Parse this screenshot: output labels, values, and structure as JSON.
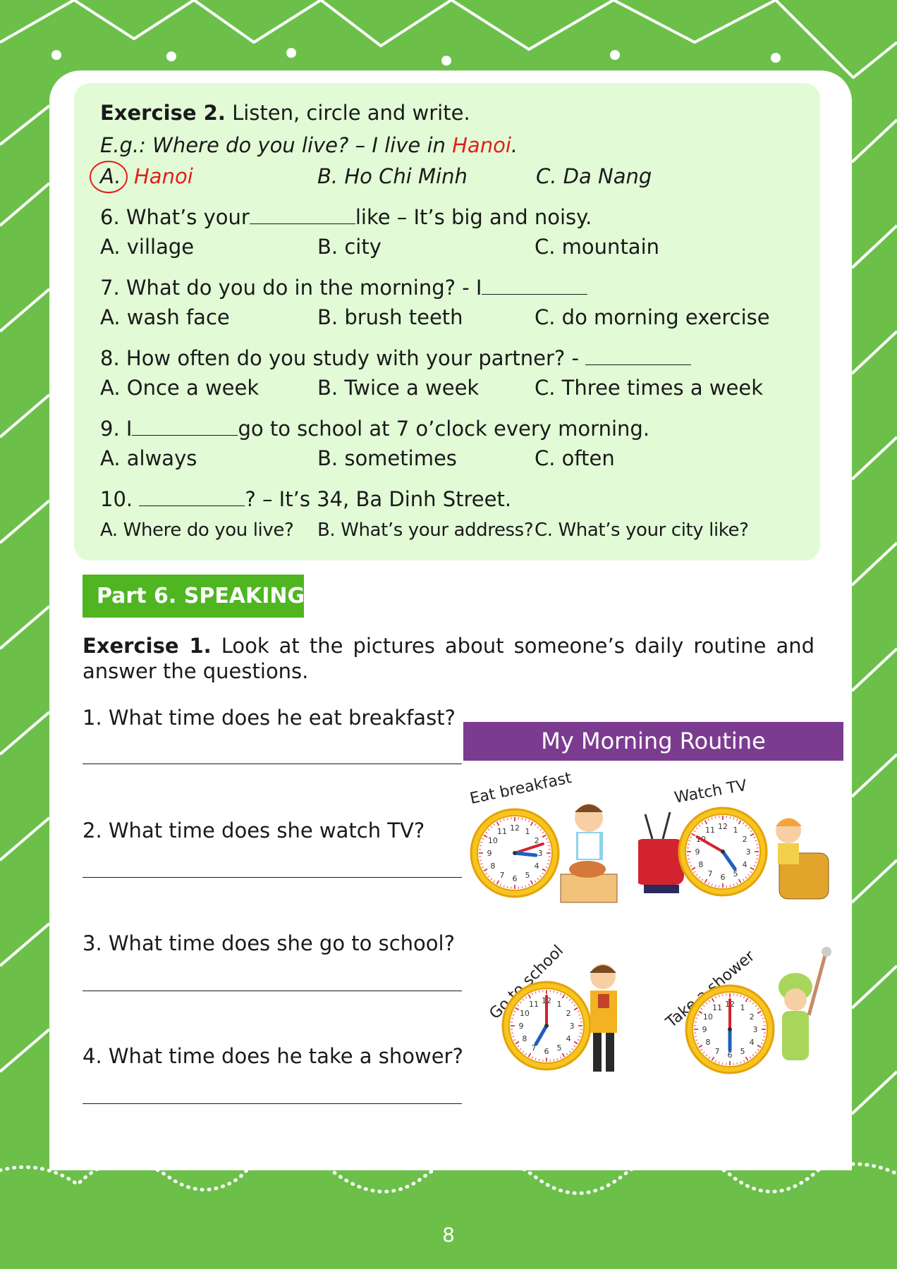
{
  "exercise2": {
    "label": "Exercise 2.",
    "instruction": "Listen, circle and write.",
    "example": {
      "question_prefix": "E.g.: Where do you live? – I live in ",
      "answer": "Hanoi",
      "suffix": ".",
      "options": [
        "A.",
        "Hanoi",
        "B. Ho Chi Minh",
        "C. Da Nang"
      ]
    },
    "questions": [
      {
        "pre": "6. What’s your",
        "post": "like – It’s big and noisy.",
        "options": [
          "A. village",
          "B. city",
          "C. mountain"
        ]
      },
      {
        "pre": "7. What do you do in the morning? - I",
        "post": "",
        "options": [
          "A. wash face",
          "B. brush teeth",
          "C. do morning exercise"
        ]
      },
      {
        "pre": "8. How often do you study with your partner? - ",
        "post": "",
        "options": [
          "A. Once a week",
          "B. Twice a week",
          "C. Three times a week"
        ]
      },
      {
        "pre": "9. I",
        "post": "go to school at 7 o’clock every morning.",
        "options": [
          "A. always",
          "B. sometimes",
          "C. often"
        ]
      },
      {
        "pre": "10. ",
        "post": "? – It’s 34, Ba Dinh Street.",
        "options": [
          "A. Where do you live?",
          "B. What’s your address?",
          "C. What’s your city like?"
        ]
      }
    ]
  },
  "part6": {
    "title": "Part 6. SPEAKING"
  },
  "exercise1": {
    "label": "Exercise 1.",
    "instruction": "Look at the pictures about someone’s daily routine and answer the questions.",
    "questions": [
      "1. What time does he eat breakfast?",
      "2. What time does she watch TV?",
      "3. What time does she go to school?",
      "4. What time does he take a shower?"
    ]
  },
  "routine": {
    "title": "My Morning Routine",
    "captions": [
      "Eat breakfast",
      "Watch TV",
      "Go to school",
      "Take a shower"
    ]
  },
  "clock_numbers": [
    "12",
    "1",
    "2",
    "3",
    "4",
    "5",
    "6",
    "7",
    "8",
    "9",
    "10",
    "11"
  ],
  "page_number": "8",
  "colors": {
    "page_green": "#6cc04a",
    "box_green": "#e2fbd6",
    "header_green": "#4fb521",
    "banner_purple": "#7b3c8f",
    "red": "#e0211b"
  }
}
